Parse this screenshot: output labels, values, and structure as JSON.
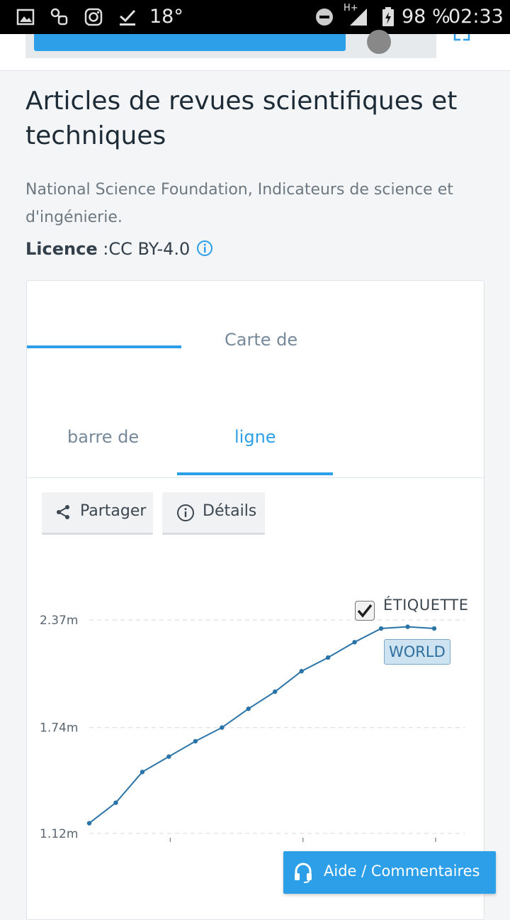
{
  "status_bar": {
    "temperature": "18°",
    "network": "H+",
    "battery": "98 %",
    "time": "02:33"
  },
  "dataset": {
    "title": "Articles de revues scientifiques et techniques",
    "source": "National Science Foundation, Indicateurs de science et d'ingénierie.",
    "licence_label": "Licence",
    "licence_value": ":CC BY-4.0"
  },
  "tabs_top": {
    "tab2_label": "Carte de"
  },
  "tabs_chart": {
    "bar_label": "barre de",
    "line_label": "ligne"
  },
  "actions": {
    "share_label": "Partager",
    "details_label": "Détails"
  },
  "chart_data": {
    "type": "line",
    "y_ticks": [
      "1.12m",
      "1.74m",
      "2.37m"
    ],
    "y_tick_values": [
      1.12,
      1.74,
      2.37
    ],
    "ylim": [
      1.12,
      2.37
    ],
    "series": [
      {
        "name": "WORLD",
        "color": "#2b74a8",
        "values": [
          1.18,
          1.3,
          1.48,
          1.57,
          1.66,
          1.74,
          1.85,
          1.95,
          2.07,
          2.15,
          2.24,
          2.32,
          2.33,
          2.32
        ]
      }
    ],
    "label_toggle": "ÉTIQUETTE",
    "label_toggle_checked": true,
    "grid": true
  },
  "help_button": {
    "label": "Aide / Commentaires"
  },
  "colors": {
    "accent": "#2c9fe8",
    "series": "#2b74a8"
  }
}
